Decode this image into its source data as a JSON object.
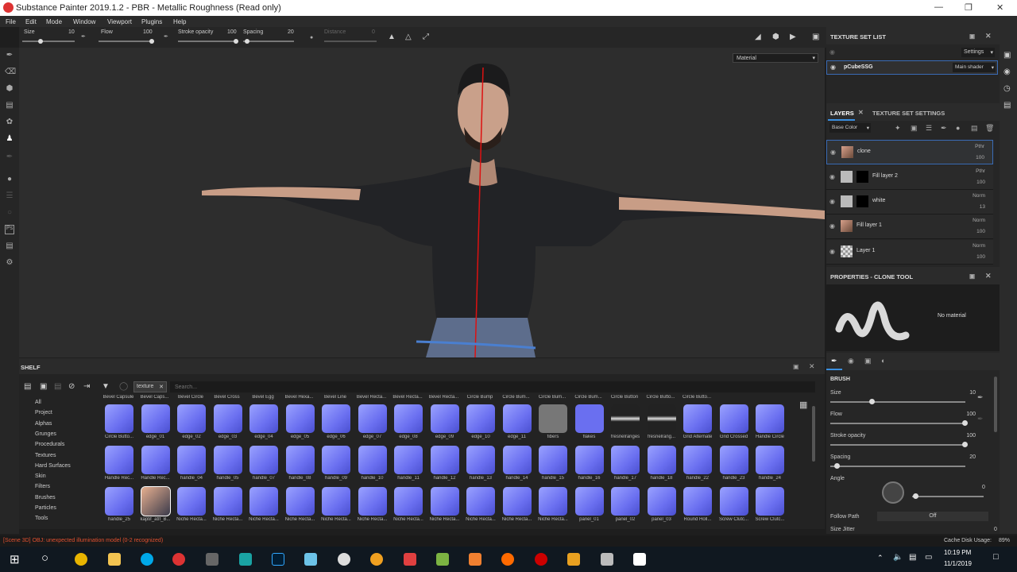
{
  "app": {
    "title": "Substance Painter 2019.1.2 - PBR - Metallic Roughness (Read only)"
  },
  "menu": [
    "File",
    "Edit",
    "Mode",
    "Window",
    "Viewport",
    "Plugins",
    "Help"
  ],
  "toolbar": {
    "size_label": "Size",
    "size_value": "10",
    "flow_label": "Flow",
    "flow_value": "100",
    "stroke_label": "Stroke opacity",
    "stroke_value": "100",
    "spacing_label": "Spacing",
    "spacing_value": "20",
    "distance_label": "Distance",
    "distance_value": "0"
  },
  "viewport": {
    "material_select": "Material"
  },
  "shelf": {
    "title": "SHELF",
    "filter_tag": "texture",
    "search_placeholder": "Search...",
    "categories": [
      "All",
      "Project",
      "Alphas",
      "Grunges",
      "Procedurals",
      "Textures",
      "Hard Surfaces",
      "Skin",
      "Filters",
      "Brushes",
      "Particles",
      "Tools"
    ],
    "top_partial_labels": [
      "Bevel Capsule",
      "Bevel Caps...",
      "Bevel Circle",
      "Bevel Cross",
      "Bevel Egg",
      "Bevel Hexa...",
      "Bevel Line",
      "Bevel Recta...",
      "Bevel Recta...",
      "Bevel Recta...",
      "Circle Bump",
      "Circle Bum...",
      "Circle Bum...",
      "Circle Bum...",
      "Circle Button",
      "Circle Butto...",
      "Circle Butto..."
    ],
    "row1": [
      "Circle Butto...",
      "edge_01",
      "edge_02",
      "edge_03",
      "edge_04",
      "edge_05",
      "edge_06",
      "edge_07",
      "edge_08",
      "edge_09",
      "edge_10",
      "edge_11",
      "fibers",
      "flakes",
      "fresnelranges",
      "fresnelrang...",
      "Grid Alternate",
      "Grid Crossed",
      "Handle Circle"
    ],
    "row2": [
      "Handle Rec...",
      "Handle Rec...",
      "handle_04",
      "handle_05",
      "handle_07",
      "handle_08",
      "handle_09",
      "handle_10",
      "handle_11",
      "handle_12",
      "handle_13",
      "handle_14",
      "handle_15",
      "handle_16",
      "handle_17",
      "handle_18",
      "handle_22",
      "handle_23",
      "handle_24"
    ],
    "row3": [
      "handle_25",
      "kaptif_atlf_B...",
      "Niche Recta...",
      "Niche Recta...",
      "Niche Recta...",
      "Niche Recta...",
      "Niche Recta...",
      "Niche Recta...",
      "Niche Recta...",
      "Niche Recta...",
      "Niche Recta...",
      "Niche Recta...",
      "Niche Recta...",
      "panel_01",
      "panel_02",
      "panel_03",
      "Round Holl...",
      "Screw Clutc...",
      "Screw Clutc..."
    ]
  },
  "texture_set_list": {
    "title": "TEXTURE SET LIST",
    "settings": "Settings",
    "item": "pCubeSSG",
    "shader": "Main shader"
  },
  "layers_panel": {
    "tab_layers": "LAYERS",
    "tab_settings": "TEXTURE SET SETTINGS",
    "channel": "Base Color",
    "layers": [
      {
        "name": "clone",
        "blend": "Pthr",
        "opacity": "100"
      },
      {
        "name": "Fill layer 2",
        "blend": "Pthr",
        "opacity": "100"
      },
      {
        "name": "white",
        "blend": "Norm",
        "opacity": "13"
      },
      {
        "name": "Fill layer 1",
        "blend": "Norm",
        "opacity": "100"
      },
      {
        "name": "Layer 1",
        "blend": "Norm",
        "opacity": "100"
      }
    ]
  },
  "properties": {
    "title": "PROPERTIES - CLONE TOOL",
    "no_material": "No material",
    "brush_header": "BRUSH",
    "size_label": "Size",
    "size_value": "10",
    "flow_label": "Flow",
    "flow_value": "100",
    "stroke_label": "Stroke opacity",
    "stroke_value": "100",
    "spacing_label": "Spacing",
    "spacing_value": "20",
    "angle_label": "Angle",
    "angle_value": "0",
    "follow_path_label": "Follow Path",
    "follow_path_value": "Off",
    "jitter_label": "Size Jitter",
    "jitter_value": "0"
  },
  "status": {
    "message": "[Scene 3D] OBJ: unexpected illumination model (0-2 recognized)",
    "cache_label": "Cache Disk Usage:",
    "cache_value": "89%"
  },
  "taskbar": {
    "time": "10:19 PM",
    "date": "11/1/2019"
  }
}
